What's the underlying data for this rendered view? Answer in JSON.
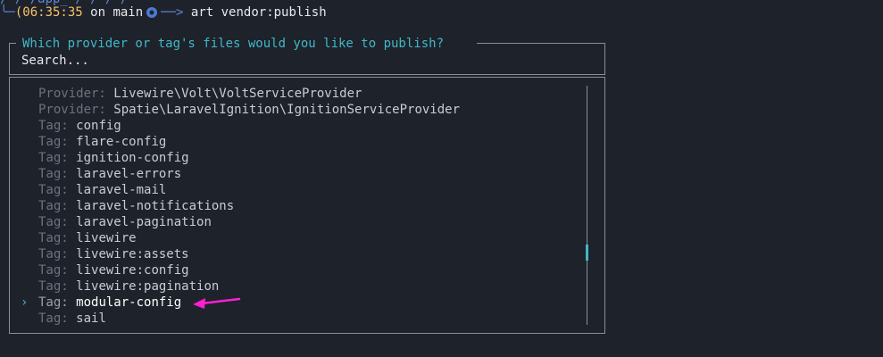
{
  "terminal": {
    "prompt_path_fragment": "/~/~/app_~/~/~/~/~",
    "prompt_corner": "╰─",
    "prompt_time": "(06:35:35",
    "prompt_on": "on",
    "prompt_branch": "main",
    "prompt_arrow": "──>",
    "command": "art vendor:publish"
  },
  "search": {
    "question": "Which provider or tag's files would you like to publish?",
    "placeholder": "Search..."
  },
  "list": {
    "selected_marker": "›",
    "items": [
      {
        "kind": "Provider:",
        "value": "Livewire\\Volt\\VoltServiceProvider",
        "selected": false
      },
      {
        "kind": "Provider:",
        "value": "Spatie\\LaravelIgnition\\IgnitionServiceProvider",
        "selected": false
      },
      {
        "kind": "Tag:",
        "value": "config",
        "selected": false
      },
      {
        "kind": "Tag:",
        "value": "flare-config",
        "selected": false
      },
      {
        "kind": "Tag:",
        "value": "ignition-config",
        "selected": false
      },
      {
        "kind": "Tag:",
        "value": "laravel-errors",
        "selected": false
      },
      {
        "kind": "Tag:",
        "value": "laravel-mail",
        "selected": false
      },
      {
        "kind": "Tag:",
        "value": "laravel-notifications",
        "selected": false
      },
      {
        "kind": "Tag:",
        "value": "laravel-pagination",
        "selected": false
      },
      {
        "kind": "Tag:",
        "value": "livewire",
        "selected": false
      },
      {
        "kind": "Tag:",
        "value": "livewire:assets",
        "selected": false
      },
      {
        "kind": "Tag:",
        "value": "livewire:config",
        "selected": false
      },
      {
        "kind": "Tag:",
        "value": "livewire:pagination",
        "selected": false
      },
      {
        "kind": "Tag:",
        "value": "modular-config",
        "selected": true
      },
      {
        "kind": "Tag:",
        "value": "sail",
        "selected": false
      }
    ]
  },
  "colors": {
    "background": "#1e222a",
    "accent": "#3fb8c9",
    "time": "#f7c26a",
    "annotation": "#ff1fd2",
    "muted": "#6b7280"
  },
  "icons": {
    "branch": "git-branch-dot-icon",
    "annotation": "magenta-arrow-icon"
  }
}
